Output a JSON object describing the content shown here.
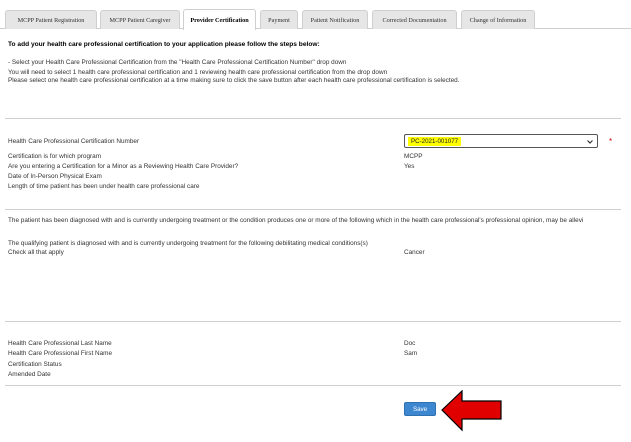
{
  "tabs": [
    {
      "label": "MCPP Patient Registration"
    },
    {
      "label": "MCPP Patient Caregiver"
    },
    {
      "label": "Provider Certification"
    },
    {
      "label": "Payment"
    },
    {
      "label": "Patient Notification"
    },
    {
      "label": "Corrected Documentation"
    },
    {
      "label": "Change of Information"
    }
  ],
  "active_tab": "Provider Certification",
  "instructions": {
    "heading": "To add your health care professional certification to your application please follow the steps below:",
    "step1": "- Select your Health Care Professional Certification from the \"Health Care Professional Certification Number\" drop down",
    "step2": "You will need to select 1 health care professional certification and 1 reviewing health care professional certification from the drop down",
    "step3": "Please select one health care professional certification at a time making sure to click the save button after each health care professional certification is selected."
  },
  "certification": {
    "number_label": "Health Care Professional Certification Number",
    "number_value": "PC-2021-001077",
    "required_mark": "*",
    "program_label": "Certification is for which program",
    "program_value": "MCPP",
    "minor_label": "Are you entering a Certification for a Minor as a Reviewing Health Care Provider?",
    "minor_value": "Yes",
    "exam_label": "Date of In-Person Physical Exam",
    "length_label": "Length of time patient has been under health care professional care"
  },
  "diagnosis": {
    "statement": "The patient has been diagnosed with and is currently undergoing treatment or the condition produces one or more of the following which in the health care professional's professional opinion, may be allevi",
    "qualifying_label": "The qualifying patient is diagnosed with and is currently undergoing treatment for the following debilitating medical conditions(s)",
    "check_label": "Check all that apply",
    "condition_value": "Cancer"
  },
  "professional": {
    "last_name_label": "Health Care Professional Last Name",
    "last_name_value": "Doc",
    "first_name_label": "Health Care Professional First Name",
    "first_name_value": "Sam",
    "status_label": "Certification Status",
    "amended_label": "Amended Date"
  },
  "actions": {
    "save_label": "Save"
  },
  "colors": {
    "accent": "#3d87d0",
    "highlight": "#ffff00",
    "arrow": "#e00000",
    "required": "#d00000"
  }
}
